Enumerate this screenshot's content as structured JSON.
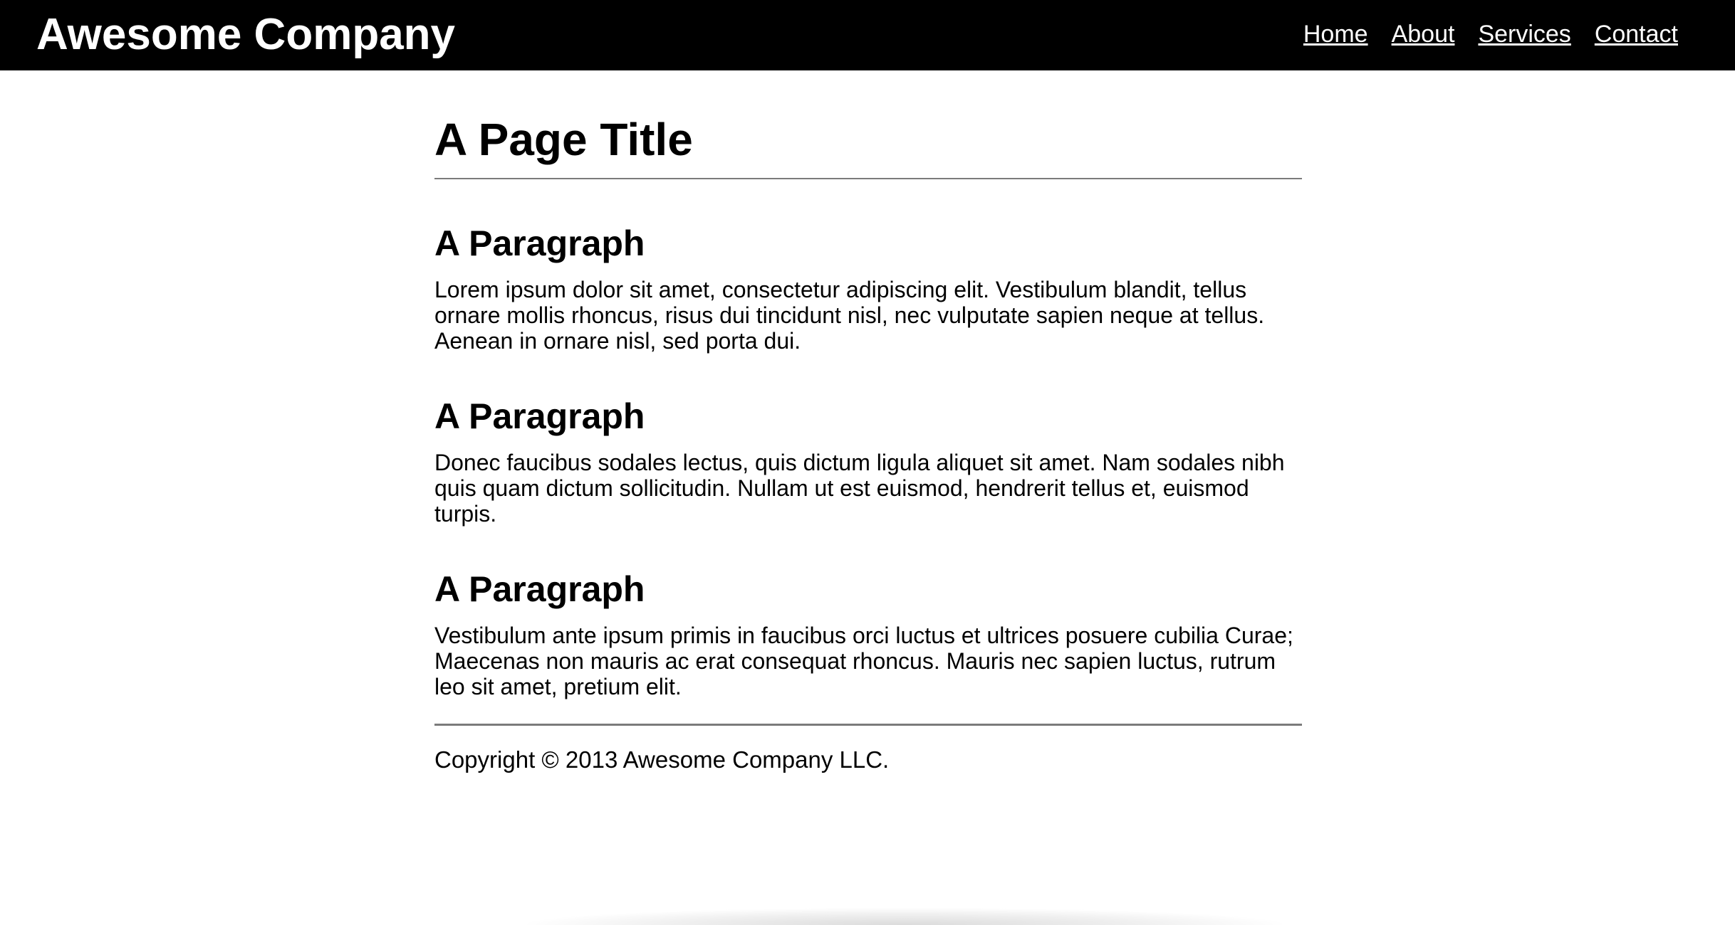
{
  "header": {
    "logo": "Awesome Company",
    "nav": [
      "Home",
      "About",
      "Services",
      "Contact"
    ]
  },
  "main": {
    "page_title": "A Page Title",
    "sections": [
      {
        "heading": "A Paragraph",
        "body": "Lorem ipsum dolor sit amet, consectetur adipiscing elit. Vestibulum blandit, tellus ornare mollis rhoncus, risus dui tincidunt nisl, nec vulputate sapien neque at tellus. Aenean in ornare nisl, sed porta dui."
      },
      {
        "heading": "A Paragraph",
        "body": "Donec faucibus sodales lectus, quis dictum ligula aliquet sit amet. Nam sodales nibh quis quam dictum sollicitudin. Nullam ut est euismod, hendrerit tellus et, euismod turpis."
      },
      {
        "heading": "A Paragraph",
        "body": "Vestibulum ante ipsum primis in faucibus orci luctus et ultrices posuere cubilia Curae; Maecenas non mauris ac erat consequat rhoncus. Mauris nec sapien luctus, rutrum leo sit amet, pretium elit."
      }
    ]
  },
  "footer": {
    "copyright": "Copyright © 2013 Awesome Company LLC."
  },
  "colors": {
    "header_background": "#000000",
    "header_text": "#ffffff",
    "page_background": "#ffffff",
    "text": "#000000",
    "rule": "#7b7b7b"
  }
}
